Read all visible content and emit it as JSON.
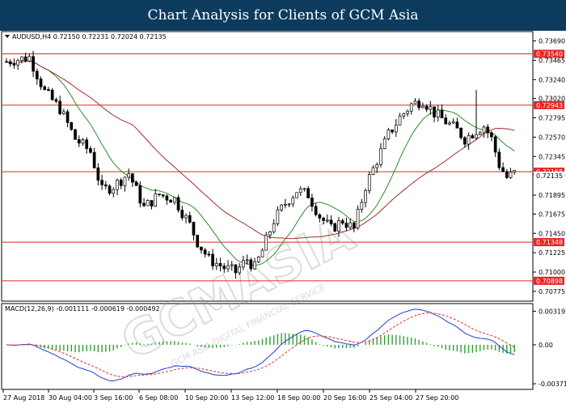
{
  "page": {
    "title": "Chart Analysis for Clients of GCM Asia"
  },
  "watermark": {
    "text": "GCMASIA",
    "subtext": "GCM ASIA DIGITAL FINANCIAL SERVICE"
  },
  "chart_data": [
    {
      "type": "candlestick",
      "symbol_header": "AUDUSD,H4  0.72150 0.72231 0.72024 0.72135",
      "ylim": [
        0.7068,
        0.7378
      ],
      "y_ticks": [
        "0.73690",
        "0.73465",
        "0.73240",
        "0.73020",
        "0.72795",
        "0.72570",
        "0.72345",
        "0.72135",
        "0.71895",
        "0.71675",
        "0.71450",
        "0.71225",
        "0.71000",
        "0.70775"
      ],
      "x_ticks": [
        "27 Aug 2018",
        "30 Aug 04:00",
        "3 Sep 16:00",
        "6 Sep 08:00",
        "10 Sep 20:00",
        "13 Sep 12:00",
        "18 Sep 00:00",
        "20 Sep 16:00",
        "25 Sep 04:00",
        "27 Sep 20:00"
      ],
      "current_price": "0.72135",
      "levels": [
        {
          "value": 0.7354,
          "label": "0.73540"
        },
        {
          "value": 0.72943,
          "label": "0.72943"
        },
        {
          "value": 0.72168,
          "label": "0.72168"
        },
        {
          "value": 0.71348,
          "label": "0.71348"
        },
        {
          "value": 0.70898,
          "label": "0.70898"
        }
      ],
      "close_path": [
        [
          0,
          0.7345
        ],
        [
          6,
          0.735
        ],
        [
          10,
          0.731
        ],
        [
          14,
          0.729
        ],
        [
          18,
          0.7255
        ],
        [
          22,
          0.724
        ],
        [
          25,
          0.7195
        ],
        [
          28,
          0.72
        ],
        [
          32,
          0.7215
        ],
        [
          36,
          0.7175
        ],
        [
          40,
          0.719
        ],
        [
          44,
          0.7185
        ],
        [
          48,
          0.7155
        ],
        [
          50,
          0.7135
        ],
        [
          53,
          0.7115
        ],
        [
          57,
          0.7105
        ],
        [
          60,
          0.71
        ],
        [
          63,
          0.7115
        ],
        [
          65,
          0.7105
        ],
        [
          67,
          0.7125
        ],
        [
          70,
          0.716
        ],
        [
          73,
          0.718
        ],
        [
          76,
          0.7195
        ],
        [
          79,
          0.719
        ],
        [
          82,
          0.7165
        ],
        [
          85,
          0.715
        ],
        [
          88,
          0.716
        ],
        [
          91,
          0.715
        ],
        [
          94,
          0.72
        ],
        [
          97,
          0.723
        ],
        [
          100,
          0.726
        ],
        [
          103,
          0.728
        ],
        [
          106,
          0.7295
        ],
        [
          109,
          0.73
        ],
        [
          112,
          0.7285
        ],
        [
          115,
          0.7275
        ],
        [
          118,
          0.7265
        ],
        [
          120,
          0.7255
        ],
        [
          123,
          0.7265
        ],
        [
          125,
          0.727
        ],
        [
          127,
          0.7255
        ],
        [
          129,
          0.7225
        ],
        [
          131,
          0.721
        ],
        [
          133,
          0.7215
        ]
      ],
      "series": [
        {
          "color": "#2e8b2e",
          "period": 12
        },
        {
          "color": "#a52a2a",
          "period": 34
        }
      ]
    },
    {
      "type": "line",
      "name": "MACD(12,26,9) -0.001111 -0.000619 -0.000492",
      "ylim": [
        -0.0041,
        0.0037
      ],
      "y_ticks": [
        "0.003192",
        "0.00",
        "-0.003718"
      ],
      "series": [
        {
          "color": "#1f3fd0",
          "style": "solid"
        },
        {
          "color": "#e03030",
          "style": "dashed"
        }
      ],
      "histogram_color": "#2fa02f"
    }
  ]
}
